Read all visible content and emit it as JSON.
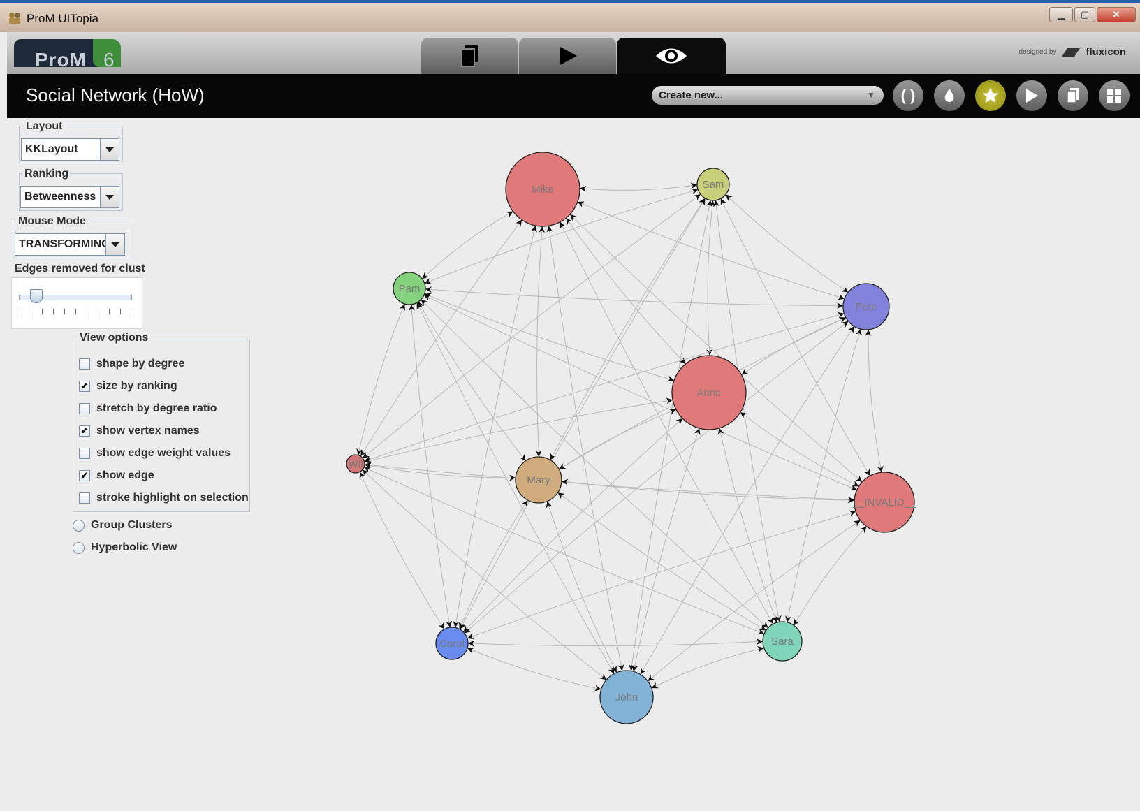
{
  "window": {
    "title": "ProM UITopia"
  },
  "header": {
    "logo_text": "ProM",
    "logo_version": "6",
    "designed_by": "designed by",
    "brand": "fluxicon"
  },
  "toolbar": {
    "view_title": "Social Network (HoW)",
    "create_new": "Create new...",
    "action_icons": [
      "refresh-icon",
      "drop-icon",
      "star-icon",
      "play-icon",
      "copy-icon",
      "grid-icon"
    ]
  },
  "controls": {
    "layout_label": "Layout",
    "layout_value": "KKLayout",
    "ranking_label": "Ranking",
    "ranking_value": "Betweenness",
    "mouse_mode_label": "Mouse Mode",
    "mouse_mode_value": "TRANSFORMING",
    "edges_removed_label": "Edges removed for clust",
    "edges_removed_level": 0.15
  },
  "view_options": {
    "title": "View options",
    "items": [
      {
        "label": "shape by degree",
        "checked": false
      },
      {
        "label": "size by ranking",
        "checked": true
      },
      {
        "label": "stretch by degree ratio",
        "checked": false
      },
      {
        "label": "show vertex names",
        "checked": true
      },
      {
        "label": "show edge weight values",
        "checked": false
      },
      {
        "label": "show edge",
        "checked": true
      },
      {
        "label": "stroke highlight on selection",
        "checked": false
      }
    ]
  },
  "radio_options": [
    {
      "label": "Group Clusters",
      "selected": false
    },
    {
      "label": "Hyperbolic View",
      "selected": false
    }
  ],
  "graph": {
    "nodes": [
      {
        "id": "Mike",
        "label": "Mike",
        "color": "#e07a7a"
      },
      {
        "id": "Sam",
        "label": "Sam",
        "color": "#c8cf7a"
      },
      {
        "id": "Pam",
        "label": "Pam",
        "color": "#86d17e"
      },
      {
        "id": "Pete",
        "label": "Pete",
        "color": "#8282dc"
      },
      {
        "id": "Anne",
        "label": "Anne",
        "color": "#e07a7a"
      },
      {
        "id": "Wil",
        "label": "Wil",
        "color": "#d27777"
      },
      {
        "id": "Mary",
        "label": "Mary",
        "color": "#cfab7e"
      },
      {
        "id": "INVALID",
        "label": "__INVALID__",
        "color": "#e07a7a"
      },
      {
        "id": "Carol",
        "label": "Carol",
        "color": "#6a8cf0"
      },
      {
        "id": "Sara",
        "label": "Sara",
        "color": "#7fd4ba"
      },
      {
        "id": "John",
        "label": "John",
        "color": "#82b2d6"
      }
    ]
  }
}
